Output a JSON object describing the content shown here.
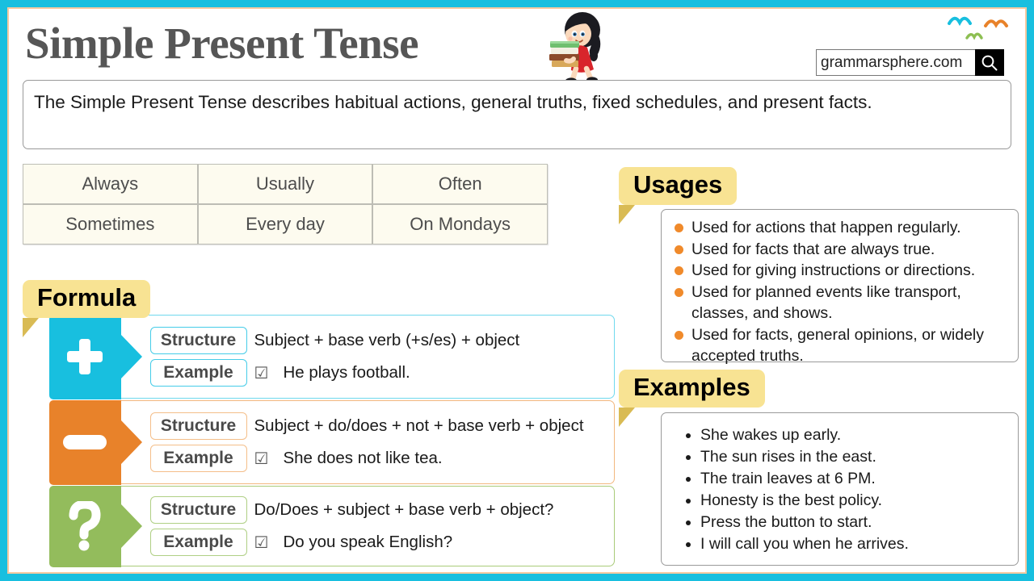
{
  "header": {
    "title": "Simple Present Tense",
    "illustration_name": "girl-carrying-books",
    "birds_name": "flying-birds-decoration",
    "search": {
      "value": "grammarsphere.com",
      "placeholder": "grammarsphere.com",
      "button_icon": "search-icon"
    }
  },
  "intro": {
    "text": "The Simple Present Tense describes habitual actions, general truths, fixed schedules, and present facts."
  },
  "adverbs": {
    "rows": [
      [
        "Always",
        "Usually",
        "Often"
      ],
      [
        "Sometimes",
        "Every day",
        "On Mondays"
      ]
    ]
  },
  "formula": {
    "banner": "Formula",
    "structure_label": "Structure",
    "example_label": "Example",
    "check_icon": "☑",
    "rows": [
      {
        "sign": "+",
        "sign_name": "plus-sign",
        "color": "#18BFDF",
        "structure": "Subject + base verb (+s/es) + object",
        "example": "He plays football."
      },
      {
        "sign": "−",
        "sign_name": "minus-sign",
        "color": "#E8822A",
        "structure": "Subject + do/does + not + base verb + object",
        "example": "She does not like tea."
      },
      {
        "sign": "?",
        "sign_name": "question-mark-sign",
        "color": "#93BC5C",
        "structure": "Do/Does + subject + base verb + object?",
        "example": "Do you speak English?"
      }
    ]
  },
  "usages": {
    "banner": "Usages",
    "bullet_color": "#F08A2B",
    "items": [
      "Used for actions that happen regularly.",
      "Used for facts that are always true.",
      "Used for giving instructions or directions.",
      "Used for planned events like transport, classes, and shows.",
      "Used for facts, general opinions, or widely accepted truths."
    ]
  },
  "examples": {
    "banner": "Examples",
    "items": [
      "She wakes up early.",
      "The sun rises in the east.",
      "The train leaves at 6 PM.",
      "Honesty is the best policy.",
      "Press the button to start.",
      "I will call you when he arrives."
    ]
  },
  "theme": {
    "frame_color": "#18BFDF",
    "banner_color": "#F8E393",
    "banner_fold_color": "#D9BB54",
    "table_cell_color": "#FDFBEF"
  }
}
